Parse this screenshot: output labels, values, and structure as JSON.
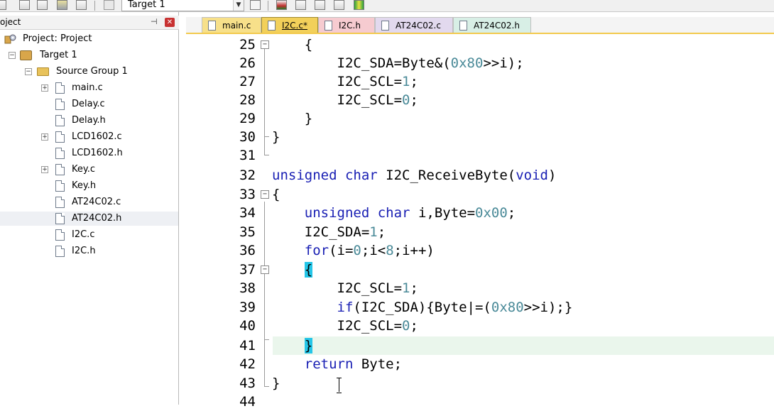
{
  "toolbar": {
    "target_select": "Target 1",
    "icons": [
      "new-file-icon",
      "save-icon",
      "save-all-icon",
      "stack-icon",
      "window-icon",
      "lock-icon",
      "build-tools-icon",
      "load-icon",
      "copy-icon",
      "options-icon",
      "filter-icon",
      "green-grid-icon"
    ]
  },
  "project_panel": {
    "title": "oject",
    "tree": {
      "project": "Project: Project",
      "target": "Target 1",
      "group": "Source Group 1",
      "files": [
        {
          "name": "main.c",
          "expandable": true
        },
        {
          "name": "Delay.c",
          "expandable": false
        },
        {
          "name": "Delay.h",
          "expandable": false
        },
        {
          "name": "LCD1602.c",
          "expandable": true
        },
        {
          "name": "LCD1602.h",
          "expandable": false
        },
        {
          "name": "Key.c",
          "expandable": true
        },
        {
          "name": "Key.h",
          "expandable": false
        },
        {
          "name": "AT24C02.c",
          "expandable": false
        },
        {
          "name": "AT24C02.h",
          "expandable": false,
          "selected": true
        },
        {
          "name": "I2C.c",
          "expandable": false
        },
        {
          "name": "I2C.h",
          "expandable": false
        }
      ]
    }
  },
  "tabs": [
    {
      "label": "main.c",
      "active": false,
      "color": "#f7e08a"
    },
    {
      "label": "I2C.c*",
      "active": true,
      "color": "#f2d05a"
    },
    {
      "label": "I2C.h",
      "active": false,
      "color": "#f6cbd0"
    },
    {
      "label": "AT24C02.c",
      "active": false,
      "color": "#e2d9ee"
    },
    {
      "label": "AT24C02.h",
      "active": false,
      "color": "#d8efe6"
    }
  ],
  "editor": {
    "current_line": 41,
    "lines": [
      {
        "n": "25",
        "code": "    {"
      },
      {
        "n": "26",
        "code": "        I2C_SDA=Byte&(0x80>>i);"
      },
      {
        "n": "27",
        "code": "        I2C_SCL=1;"
      },
      {
        "n": "28",
        "code": "        I2C_SCL=0;"
      },
      {
        "n": "29",
        "code": "    }"
      },
      {
        "n": "30",
        "code": "}"
      },
      {
        "n": "31",
        "code": ""
      },
      {
        "n": "32",
        "code": "unsigned char I2C_ReceiveByte(void)"
      },
      {
        "n": "33",
        "code": "{"
      },
      {
        "n": "34",
        "code": "    unsigned char i,Byte=0x00;"
      },
      {
        "n": "35",
        "code": "    I2C_SDA=1;"
      },
      {
        "n": "36",
        "code": "    for(i=0;i<8;i++)"
      },
      {
        "n": "37",
        "code": "    {"
      },
      {
        "n": "38",
        "code": "        I2C_SCL=1;"
      },
      {
        "n": "39",
        "code": "        if(I2C_SDA){Byte|=(0x80>>i);}"
      },
      {
        "n": "40",
        "code": "        I2C_SCL=0;"
      },
      {
        "n": "41",
        "code": "    }"
      },
      {
        "n": "42",
        "code": "    return Byte;"
      },
      {
        "n": "43",
        "code": "}"
      },
      {
        "n": "44",
        "code": ""
      }
    ]
  }
}
